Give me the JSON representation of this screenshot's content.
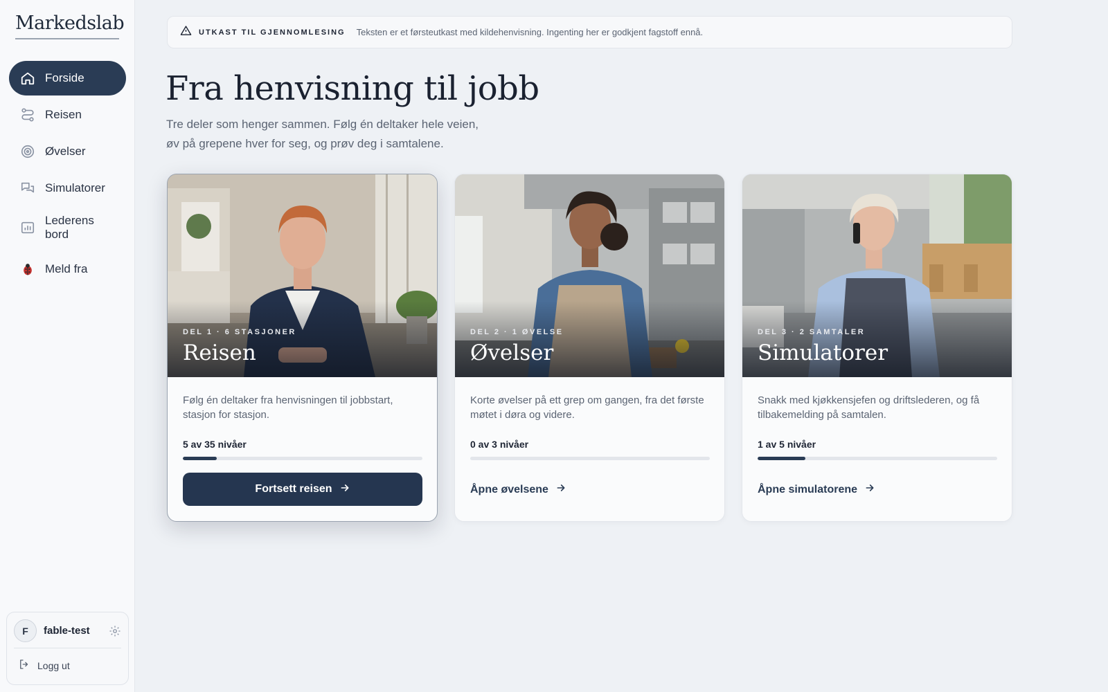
{
  "app": {
    "logo": "Markedslab"
  },
  "sidebar": {
    "items": [
      {
        "label": "Forside",
        "icon": "home-icon",
        "active": true
      },
      {
        "label": "Reisen",
        "icon": "route-icon"
      },
      {
        "label": "Øvelser",
        "icon": "target-icon"
      },
      {
        "label": "Simulatorer",
        "icon": "chat-bubbles-icon"
      },
      {
        "label": "Lederens bord",
        "icon": "bar-chart-icon"
      },
      {
        "label": "Meld fra",
        "icon": "ladybug-icon"
      }
    ],
    "user": {
      "initial": "F",
      "name": "fable-test",
      "settings_icon": "gear-icon",
      "logout_label": "Logg ut"
    }
  },
  "banner": {
    "icon": "warning-triangle-icon",
    "title": "UTKAST TIL GJENNOMLESING",
    "text": "Teksten er et førsteutkast med kildehenvisning. Ingenting her er godkjent fagstoff ennå."
  },
  "main": {
    "title": "Fra henvisning til jobb",
    "subtitle_line1": "Tre deler som henger sammen. Følg én deltaker hele veien,",
    "subtitle_line2": "øv på grepene hver for seg, og prøv deg i samtalene."
  },
  "cards": [
    {
      "kicker": "DEL 1 · 6 STASJONER",
      "title": "Reisen",
      "description": "Følg én deltaker fra henvisningen til jobbstart, stasjon for stasjon.",
      "progress_label": "5 av 35 nivåer",
      "progress": 0.143,
      "cta": "Fortsett reisen",
      "cta_style": "button"
    },
    {
      "kicker": "DEL 2 · 1 ØVELSE",
      "title": "Øvelser",
      "description": "Korte øvelser på ett grep om gangen, fra det første møtet i døra og videre.",
      "progress_label": "0 av 3 nivåer",
      "progress": 0,
      "cta": "Åpne øvelsene",
      "cta_style": "link"
    },
    {
      "kicker": "DEL 3 · 2 SAMTALER",
      "title": "Simulatorer",
      "description": "Snakk med kjøkkensjefen og driftslederen, og få tilbakemelding på samtalen.",
      "progress_label": "1 av 5 nivåer",
      "progress": 0.2,
      "cta": "Åpne simulatorene",
      "cta_style": "link"
    }
  ],
  "colors": {
    "accent": "#2a3c55",
    "background": "#eef1f5"
  }
}
